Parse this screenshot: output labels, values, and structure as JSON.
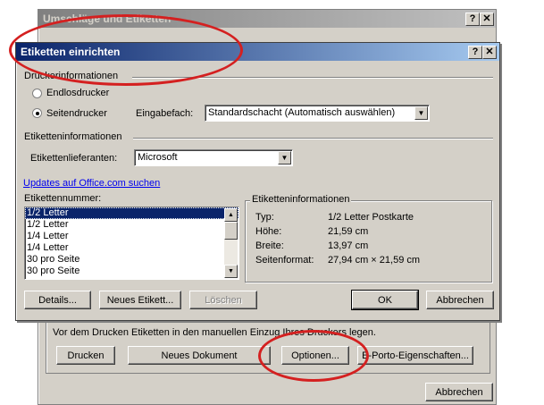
{
  "back_dialog": {
    "title": "Umschläge und Etiketten",
    "help_btn": "?",
    "close_btn": "✕",
    "hint": "Vor dem Drucken Etiketten in den manuellen Einzug Ihres Druckers legen.",
    "buttons": {
      "print": "Drucken",
      "new_document": "Neues Dokument",
      "options": "Optionen...",
      "postage": "E-Porto-Eigenschaften...",
      "cancel": "Abbrechen"
    }
  },
  "dialog": {
    "title": "Etiketten einrichten",
    "help_btn": "?",
    "close_btn": "✕",
    "printer_section": "Druckerinformationen",
    "radio_continuous": "Endlosdrucker",
    "radio_page": "Seitendrucker",
    "tray_label": "Eingabefach:",
    "tray_value": "Standardschacht (Automatisch auswählen)",
    "label_info_section": "Etiketteninformationen",
    "vendor_label": "Etikettenlieferanten:",
    "vendor_value": "Microsoft",
    "update_link": "Updates auf Office.com suchen",
    "product_label": "Etikettennummer:",
    "products": [
      "1/2 Letter",
      "1/2 Letter",
      "1/4 Letter",
      "1/4 Letter",
      "30 pro Seite",
      "30 pro Seite"
    ],
    "details_group": "Etiketteninformationen",
    "details": [
      {
        "key": "Typ:",
        "value": "1/2 Letter Postkarte"
      },
      {
        "key": "Höhe:",
        "value": "21,59 cm"
      },
      {
        "key": "Breite:",
        "value": "13,97 cm"
      },
      {
        "key": "Seitenformat:",
        "value": "27,94 cm × 21,59 cm"
      }
    ],
    "buttons": {
      "details": "Details...",
      "new_label": "Neues Etikett...",
      "delete": "Löschen",
      "ok": "OK",
      "cancel": "Abbrechen"
    }
  },
  "colors": {
    "annotation": "#d42020",
    "title_active": "#0a246a",
    "selection": "#0a246a"
  }
}
